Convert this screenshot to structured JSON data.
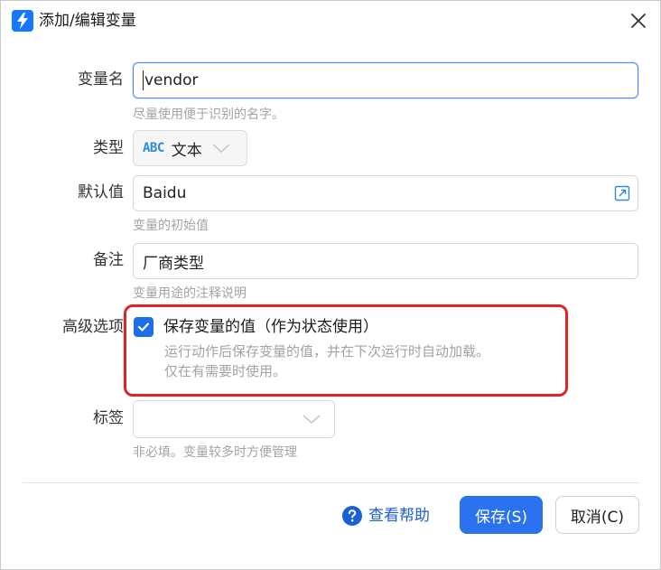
{
  "dialog": {
    "title": "添加/编辑变量",
    "close_icon": "close-icon"
  },
  "fields": {
    "name": {
      "label": "变量名",
      "value": "vendor",
      "help": "尽量使用便于识别的名字。"
    },
    "type": {
      "label": "类型",
      "icon_text": "ABC",
      "value": "文本"
    },
    "default": {
      "label": "默认值",
      "value": "Baidu",
      "help": "变量的初始值"
    },
    "note": {
      "label": "备注",
      "value": "厂商类型",
      "help": "变量用途的注释说明"
    },
    "advanced": {
      "label": "高级选项",
      "checkbox_label": "保存变量的值（作为状态使用）",
      "checked": true,
      "desc_line1": "运行动作后保存变量的值，并在下次运行时自动加载。",
      "desc_line2": "仅在有需要时使用。"
    },
    "tags": {
      "label": "标签",
      "value": "",
      "help": "非必填。变量较多时方便管理"
    }
  },
  "footer": {
    "help_link": "查看帮助",
    "save_button": "保存(S)",
    "cancel_button": "取消(C)"
  },
  "colors": {
    "accent": "#2a72f0",
    "highlight_border": "#e02424",
    "help_text": "#a3a3a3"
  }
}
